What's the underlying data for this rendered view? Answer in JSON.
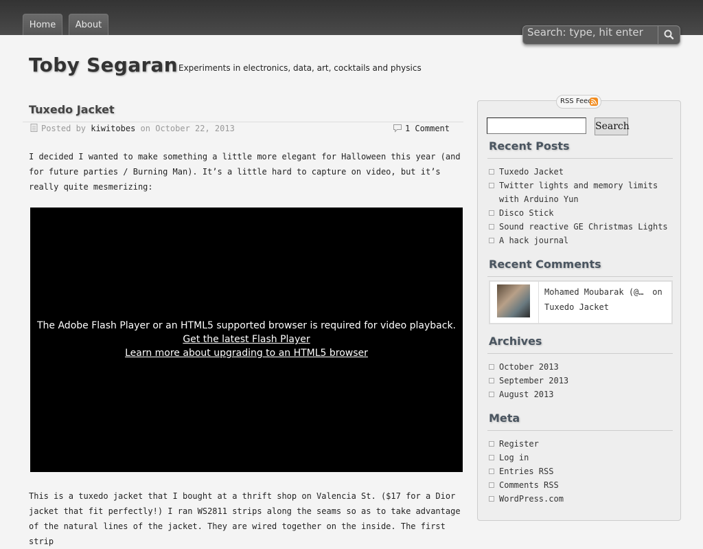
{
  "nav": {
    "items": [
      {
        "label": "Home"
      },
      {
        "label": "About"
      }
    ],
    "search_placeholder": "Search: type, hit enter"
  },
  "site": {
    "title": "Toby Segaran",
    "description": "Experiments in electronics, data, art, cocktails and physics"
  },
  "post": {
    "title": "Tuxedo Jacket",
    "meta_prefix": "Posted by",
    "author": "kiwitobes",
    "meta_on": "on",
    "date": "October 22, 2013",
    "comments": "1 Comment",
    "paragraph1": "I decided I wanted to make something a little more elegant for Halloween this year (and for future parties / Burning Man). It’s a little hard to capture on video, but it’s really quite mesmerizing:",
    "video": {
      "message": "The Adobe Flash Player or an HTML5 supported browser is required for video playback.",
      "link1": "Get the latest Flash Player",
      "link2": "Learn more about upgrading to an HTML5 browser"
    },
    "paragraph2": "This is a tuxedo jacket that I bought at a thrift shop on Valencia St. ($17 for a Dior jacket that fit perfectly!) I ran WS2811 strips along the seams so as to take advantage of the natural lines of the jacket. They are wired together on the inside. The first strip"
  },
  "sidebar": {
    "rss_label": "RSS Feed",
    "search_button": "Search",
    "recent_posts": {
      "title": "Recent Posts",
      "items": [
        "Tuxedo Jacket",
        "Twitter lights and memory limits with Arduino Yun",
        "Disco Stick",
        "Sound reactive GE Christmas Lights",
        "A hack journal"
      ]
    },
    "recent_comments": {
      "title": "Recent Comments",
      "author": "Mohamed Moubarak (@m…",
      "on": "on",
      "post": "Tuxedo Jacket"
    },
    "archives": {
      "title": "Archives",
      "items": [
        "October 2013",
        "September 2013",
        "August 2013"
      ]
    },
    "meta": {
      "title": "Meta",
      "items": [
        "Register",
        "Log in",
        "Entries RSS",
        "Comments RSS",
        "WordPress.com"
      ]
    }
  }
}
